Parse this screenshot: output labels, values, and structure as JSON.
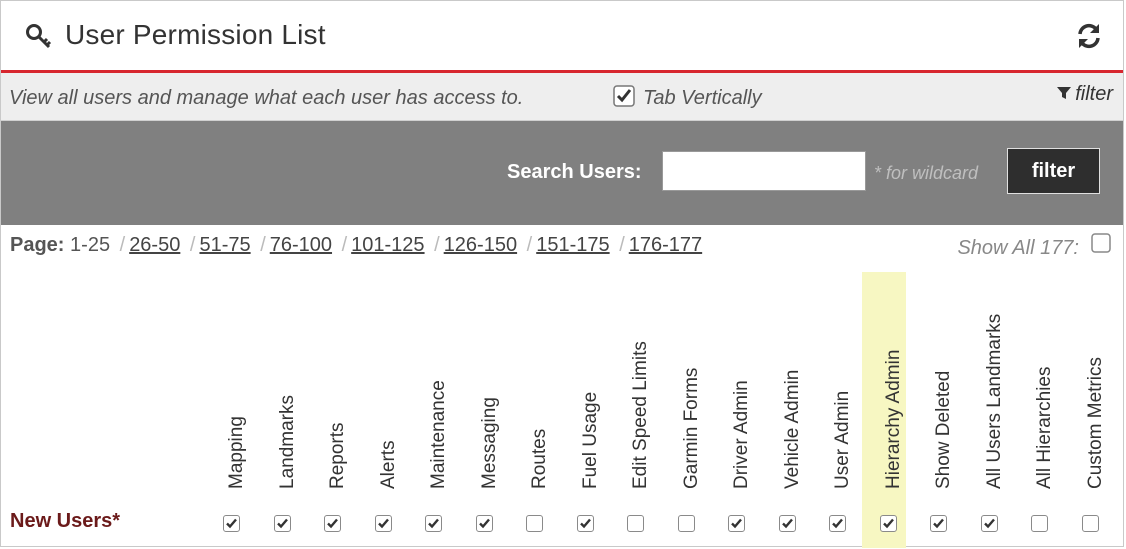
{
  "header": {
    "title": "User Permission List",
    "icon": "key-icon",
    "refresh_icon": "refresh-icon"
  },
  "desc_bar": {
    "description": "View all users and manage what each user has access to.",
    "tab_vertically_label": "Tab Vertically",
    "tab_vertically_checked": true,
    "filter_link": "filter"
  },
  "search": {
    "label": "Search Users:",
    "value": "",
    "hint": "* for wildcard",
    "button": "filter"
  },
  "pager": {
    "label": "Page:",
    "current": "1-25",
    "links": [
      "26-50",
      "51-75",
      "76-100",
      "101-125",
      "126-150",
      "151-175",
      "176-177"
    ],
    "show_all_label": "Show All 177:",
    "show_all_checked": false
  },
  "columns": [
    "Mapping",
    "Landmarks",
    "Reports",
    "Alerts",
    "Maintenance",
    "Messaging",
    "Routes",
    "Fuel Usage",
    "Edit Speed Limits",
    "Garmin Forms",
    "Driver Admin",
    "Vehicle Admin",
    "User Admin",
    "Hierarchy Admin",
    "Show Deleted",
    "All Users Landmarks",
    "All Hierarchies",
    "Custom Metrics"
  ],
  "highlighted_column": "Hierarchy Admin",
  "row": {
    "label": "New Users*",
    "checks": [
      true,
      true,
      true,
      true,
      true,
      true,
      false,
      true,
      false,
      false,
      true,
      true,
      true,
      true,
      true,
      true,
      false,
      false
    ]
  },
  "colors": {
    "accent": "#d7262e",
    "search_bar": "#808080",
    "row_label": "#6b1a1a",
    "highlight": "#f7f7c2"
  }
}
